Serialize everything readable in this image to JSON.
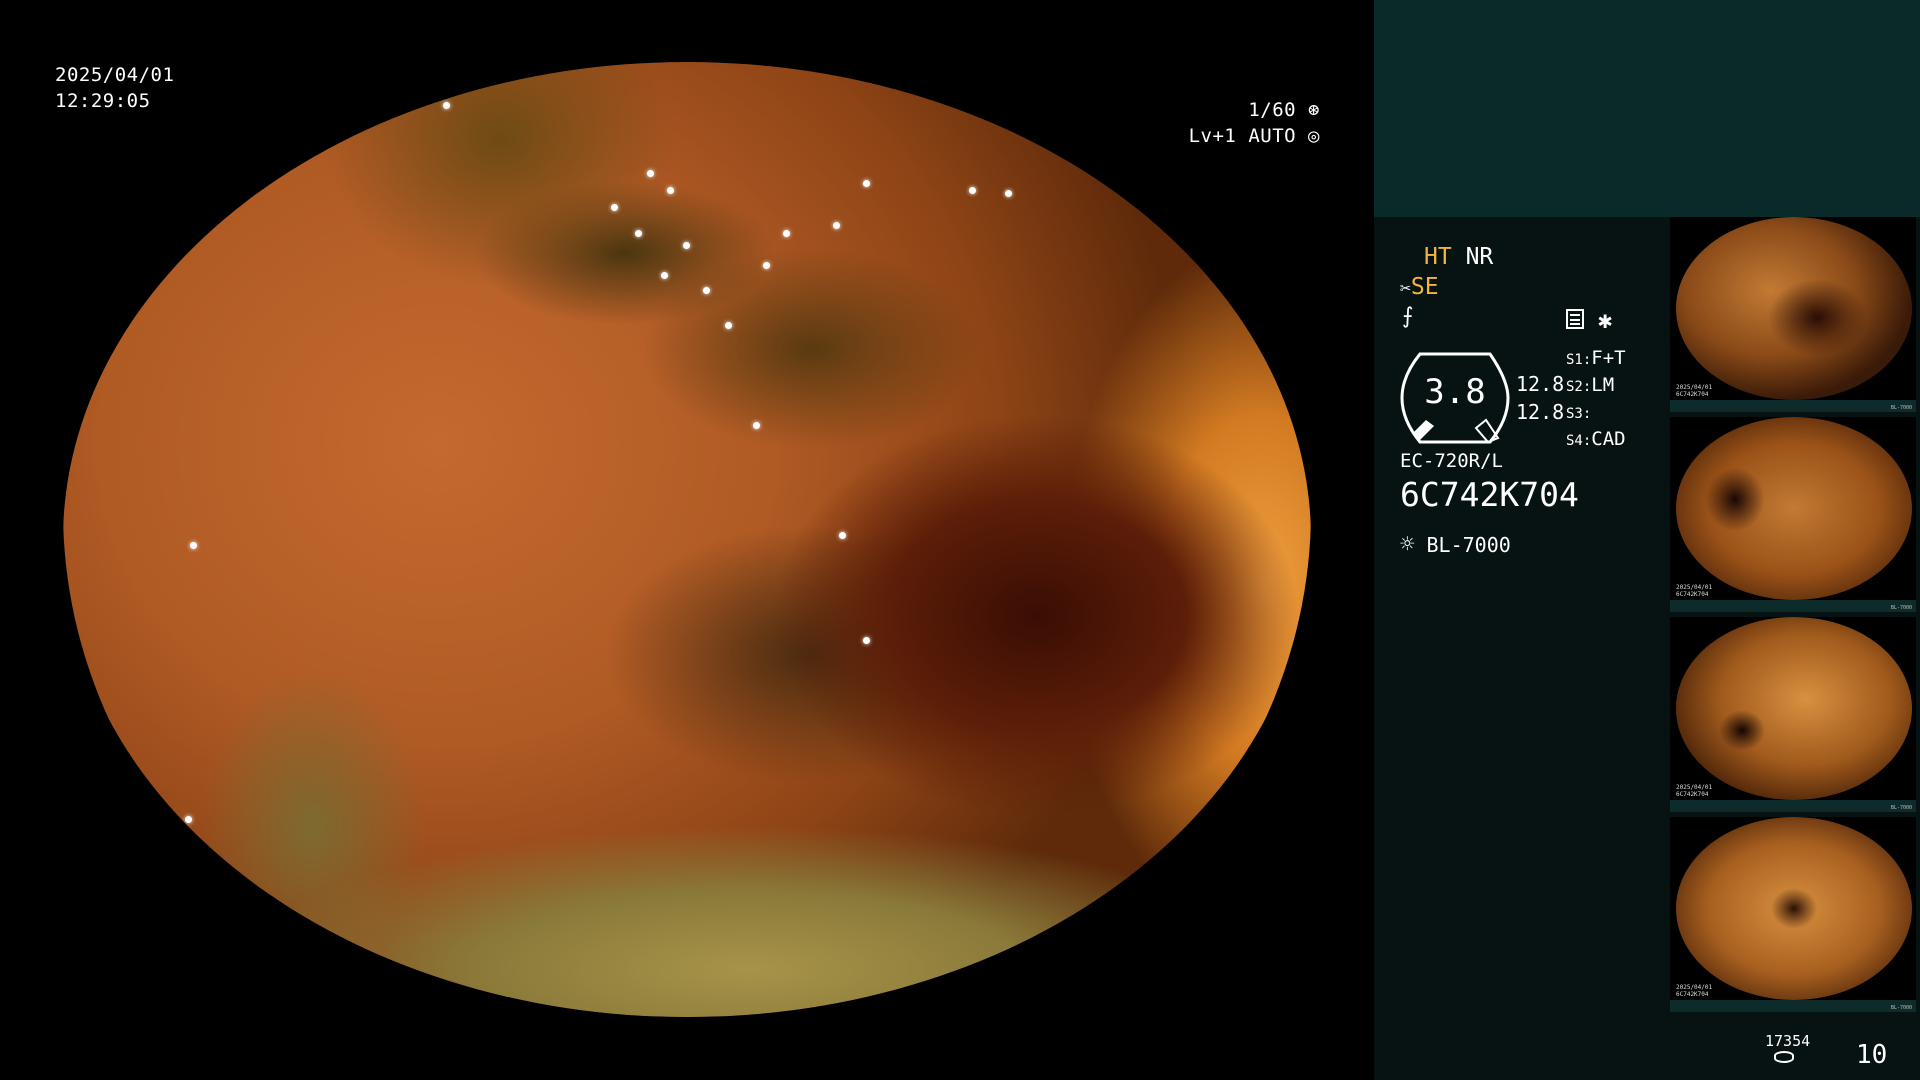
{
  "scope": {
    "date": "2025/04/01",
    "time": "12:29:05",
    "shutter": "1/60",
    "level": "Lv+1",
    "iris": "AUTO"
  },
  "panel": {
    "ht": "HT",
    "nr": "NR",
    "se": "SE",
    "gauge_value": "3.8",
    "value_a": "12.8",
    "value_b": "12.8",
    "slots": [
      {
        "key": "S1:",
        "value": "F+T"
      },
      {
        "key": "S2:",
        "value": "LM"
      },
      {
        "key": "S3:",
        "value": ""
      },
      {
        "key": "S4:",
        "value": "CAD"
      }
    ],
    "scope_model": "EC-720R/L",
    "serial": "6C742K704",
    "light_source": "BL-7000",
    "storage_count": "17354",
    "image_count": "10"
  },
  "thumbnails": [
    {
      "caption_date": "2025/04/01",
      "caption_serial": "6C742K704",
      "caption_model": "BL-7000"
    },
    {
      "caption_date": "2025/04/01",
      "caption_serial": "6C742K704",
      "caption_model": "BL-7000"
    },
    {
      "caption_date": "2025/04/01",
      "caption_serial": "6C742K704",
      "caption_model": "BL-7000"
    },
    {
      "caption_date": "2025/04/01",
      "caption_serial": "6C742K704",
      "caption_model": "BL-7000"
    }
  ],
  "colors": {
    "accent_yellow": "#f2b53c",
    "panel_bg": "#071313",
    "panel_top_bg": "#0a2a2a"
  },
  "icons": [
    "shutter-icon",
    "iris-icon",
    "scissors-icon",
    "edge-icon",
    "settings-list-icon",
    "asterisk-icon",
    "light-source-icon",
    "storage-icon"
  ]
}
